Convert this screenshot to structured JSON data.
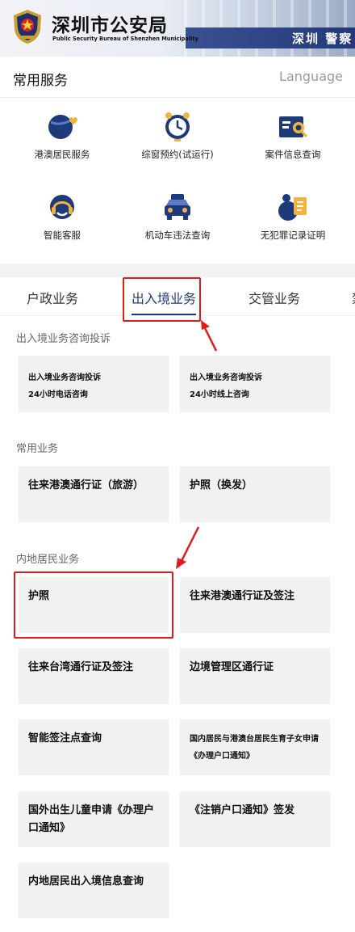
{
  "header": {
    "title": "深圳市公安局",
    "subtitle": "Public Security Bureau of Shenzhen Municipality",
    "building_sign": "深圳 警察"
  },
  "services": {
    "title": "常用服务",
    "language": "Language",
    "items": [
      {
        "label": "港澳居民服务",
        "icon": "globe-heart-icon"
      },
      {
        "label": "综窗预约(试运行)",
        "icon": "alarm-clock-icon"
      },
      {
        "label": "案件信息查询",
        "icon": "folder-search-icon"
      },
      {
        "label": "智能客服",
        "icon": "headset-icon"
      },
      {
        "label": "机动车违法查询",
        "icon": "car-icon"
      },
      {
        "label": "无犯罪记录证明",
        "icon": "certificate-icon"
      }
    ]
  },
  "tabs": [
    "户政业务",
    "出入境业务",
    "交管业务",
    "禁"
  ],
  "active_tab": "出入境业务",
  "sections": {
    "consult": {
      "title": "出入境业务咨询投诉",
      "cards": [
        {
          "line1": "出入境业务咨询投诉",
          "line2": "24小时电话咨询"
        },
        {
          "line1": "出入境业务咨询投诉",
          "line2": "24小时线上咨询"
        }
      ]
    },
    "common": {
      "title": "常用业务",
      "cards": [
        "往来港澳通行证（旅游）",
        "护照（换发）"
      ]
    },
    "mainland": {
      "title": "内地居民业务",
      "cards": [
        "护照",
        "往来港澳通行证及签注",
        "往来台湾通行证及签注",
        "边境管理区通行证",
        "智能签注点查询",
        "国内居民与港澳台居民生育子女申请《办理户口通知》",
        "国外出生儿童申请《办理户口通知》",
        "《注销户口通知》签发",
        "内地居民出入境信息查询"
      ]
    }
  },
  "colors": {
    "brand": "#1f3a7a",
    "highlight": "#e01b1b",
    "card_bg": "#f1f1f1"
  }
}
